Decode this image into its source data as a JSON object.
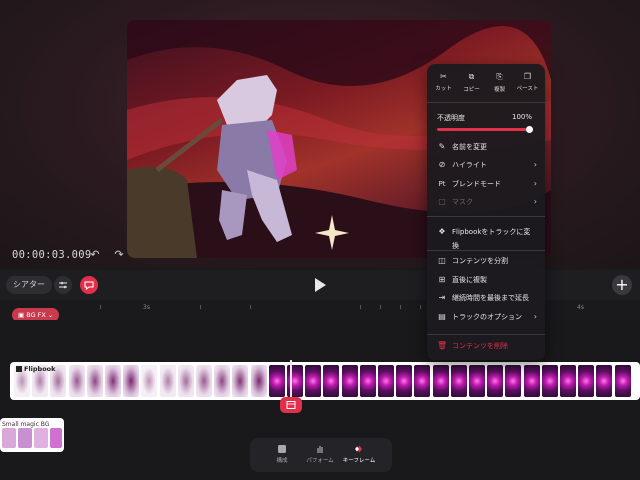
{
  "timecode": "00:00:03.009",
  "toolbar": {
    "theater_label": "シアター",
    "add_label": "+"
  },
  "ruler": {
    "labels": [
      "3s",
      "4s"
    ]
  },
  "fx_tag": {
    "label": "BG FX"
  },
  "tracks": {
    "main_label": "Flipbook",
    "small_label": "Small magic BG"
  },
  "tabs": [
    {
      "label": "構成"
    },
    {
      "label": "パフォーム"
    },
    {
      "label": "キーフレーム"
    }
  ],
  "menu": {
    "top": [
      {
        "icon": "scissors-icon",
        "label": "カット"
      },
      {
        "icon": "copy-icon",
        "label": "コピー"
      },
      {
        "icon": "duplicate-icon",
        "label": "複製"
      },
      {
        "icon": "paste-icon",
        "label": "ペースト"
      }
    ],
    "opacity_label": "不透明度",
    "opacity_value": "100%",
    "opacity_fraction": 1.0,
    "items": [
      {
        "label": "名前を変更",
        "icon": "pencil-icon"
      },
      {
        "label": "ハイライト",
        "icon": "no-highlight-icon"
      },
      {
        "label": "ブレンドモード",
        "icon": "pt-icon",
        "icon_text": "Pt"
      },
      {
        "label": "マスク",
        "icon": "mask-icon"
      },
      {
        "label": "Flipbookをトラックに変換",
        "icon": "layers-icon"
      },
      {
        "label": "コンテンツを分割",
        "icon": "split-icon"
      },
      {
        "label": "直後に複製",
        "icon": "duplicate-after-icon"
      },
      {
        "label": "継続時間を最後まで延長",
        "icon": "extend-icon"
      },
      {
        "label": "トラックのオプション",
        "icon": "options-icon"
      },
      {
        "label": "コンテンツを削除",
        "icon": "trash-icon"
      }
    ]
  },
  "colors": {
    "accent": "#e0304a",
    "menu_bg": "#1c1a1e"
  }
}
